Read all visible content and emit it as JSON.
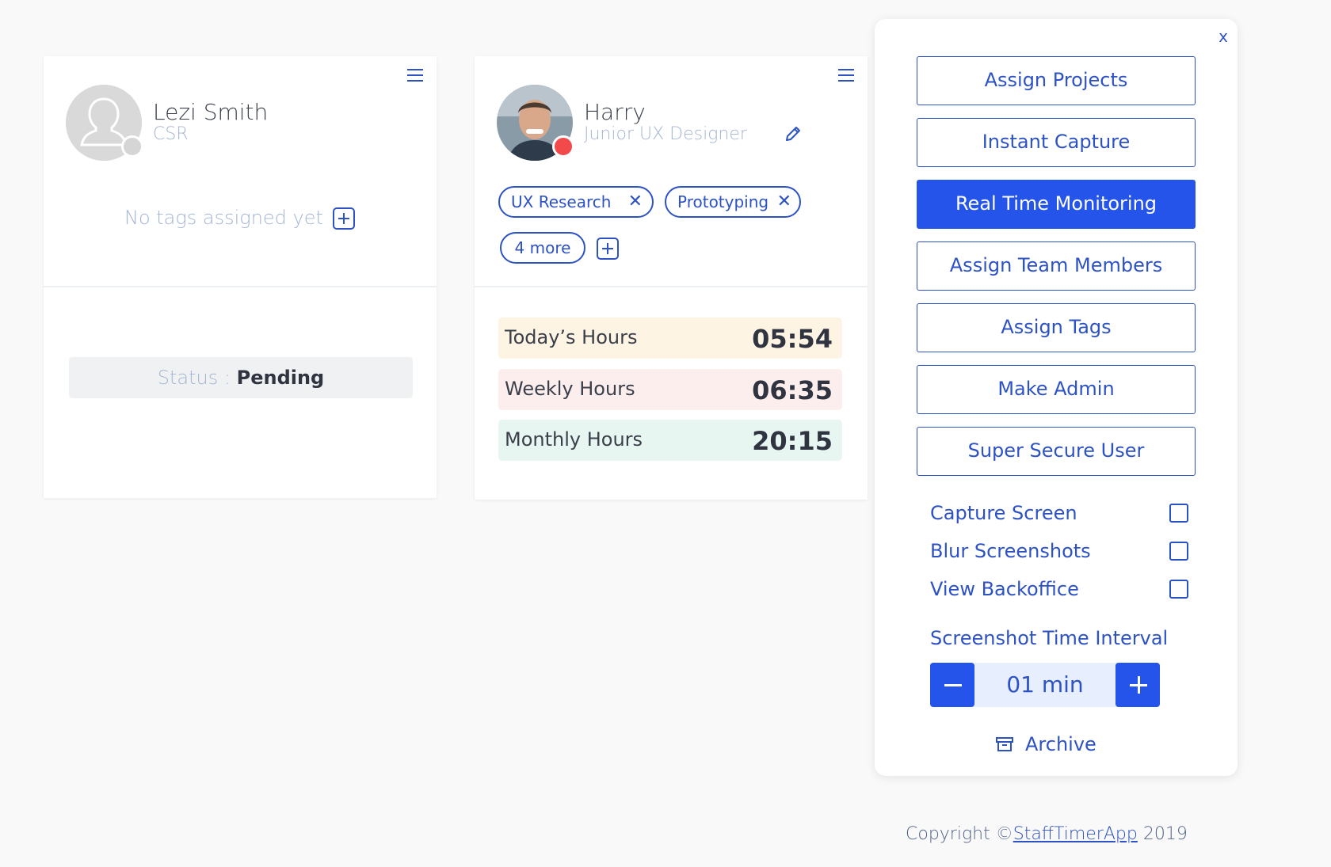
{
  "card_pending": {
    "name": "Lezi Smith",
    "role": "CSR",
    "no_tags_text": "No tags assigned yet",
    "status_label": "Status :",
    "status_value": "Pending"
  },
  "card_harry": {
    "name": "Harry",
    "role": "Junior UX Designer",
    "tags": [
      {
        "label": "UX Research"
      },
      {
        "label": "Prototyping"
      }
    ],
    "more_label": "4 more",
    "hours": [
      {
        "label": "Today’s Hours",
        "value": "05:54",
        "color": "#fdf4e3"
      },
      {
        "label": "Weekly Hours",
        "value": "06:35",
        "color": "#fdeeee"
      },
      {
        "label": "Monthly Hours",
        "value": "20:15",
        "color": "#e8f6f2"
      }
    ]
  },
  "panel": {
    "close_label": "x",
    "actions": [
      {
        "label": "Assign Projects",
        "active": false
      },
      {
        "label": "Instant Capture",
        "active": false
      },
      {
        "label": "Real Time Monitoring",
        "active": true
      },
      {
        "label": "Assign Team Members",
        "active": false
      },
      {
        "label": "Assign Tags",
        "active": false
      },
      {
        "label": "Make Admin",
        "active": false
      },
      {
        "label": "Super Secure User",
        "active": false
      }
    ],
    "toggles": [
      {
        "label": "Capture Screen",
        "checked": false
      },
      {
        "label": "Blur Screenshots",
        "checked": false
      },
      {
        "label": "View Backoffice",
        "checked": false
      }
    ],
    "interval_label": "Screenshot Time Interval",
    "interval_value": "01 min",
    "archive_label": "Archive"
  },
  "footer": {
    "prefix": "Copyright ©",
    "link": "StaffTimerApp",
    "suffix": " 2019"
  },
  "colors": {
    "accent": "#2554ea",
    "text_blue": "#2d52c4",
    "muted": "#a5b6d3",
    "status_offline": "#d5d5d5",
    "status_busy": "#f24a4a"
  },
  "icons": [
    "menu-icon",
    "user-placeholder-icon",
    "plus-icon",
    "close-icon",
    "edit-icon",
    "minus-icon",
    "archive-icon"
  ]
}
